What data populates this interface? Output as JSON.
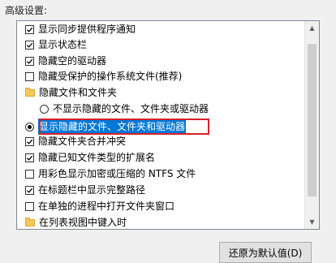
{
  "section_label": "高级设置:",
  "items": [
    {
      "type": "checkbox",
      "checked": true,
      "label": "显示同步提供程序通知"
    },
    {
      "type": "checkbox",
      "checked": true,
      "label": "显示状态栏"
    },
    {
      "type": "checkbox",
      "checked": true,
      "label": "隐藏空的驱动器"
    },
    {
      "type": "checkbox",
      "checked": false,
      "label": "隐藏受保护的操作系统文件(推荐)"
    },
    {
      "type": "folder",
      "label": "隐藏文件和文件夹"
    },
    {
      "type": "radio",
      "selected": false,
      "label": "不显示隐藏的文件、文件夹或驱动器"
    },
    {
      "type": "radio",
      "selected": true,
      "label": "显示隐藏的文件、文件夹和驱动器"
    },
    {
      "type": "checkbox",
      "checked": true,
      "label": "隐藏文件夹合并冲突"
    },
    {
      "type": "checkbox",
      "checked": true,
      "label": "隐藏已知文件类型的扩展名"
    },
    {
      "type": "checkbox",
      "checked": false,
      "label": "用彩色显示加密或压缩的 NTFS 文件"
    },
    {
      "type": "checkbox",
      "checked": true,
      "label": "在标题栏中显示完整路径"
    },
    {
      "type": "checkbox",
      "checked": false,
      "label": "在单独的进程中打开文件夹窗口"
    },
    {
      "type": "folder",
      "label": "在列表视图中键入时"
    }
  ],
  "restore_button": "还原为默认值(D)",
  "colors": {
    "highlight": "#0078d7",
    "annotation_border": "#d6202a"
  }
}
